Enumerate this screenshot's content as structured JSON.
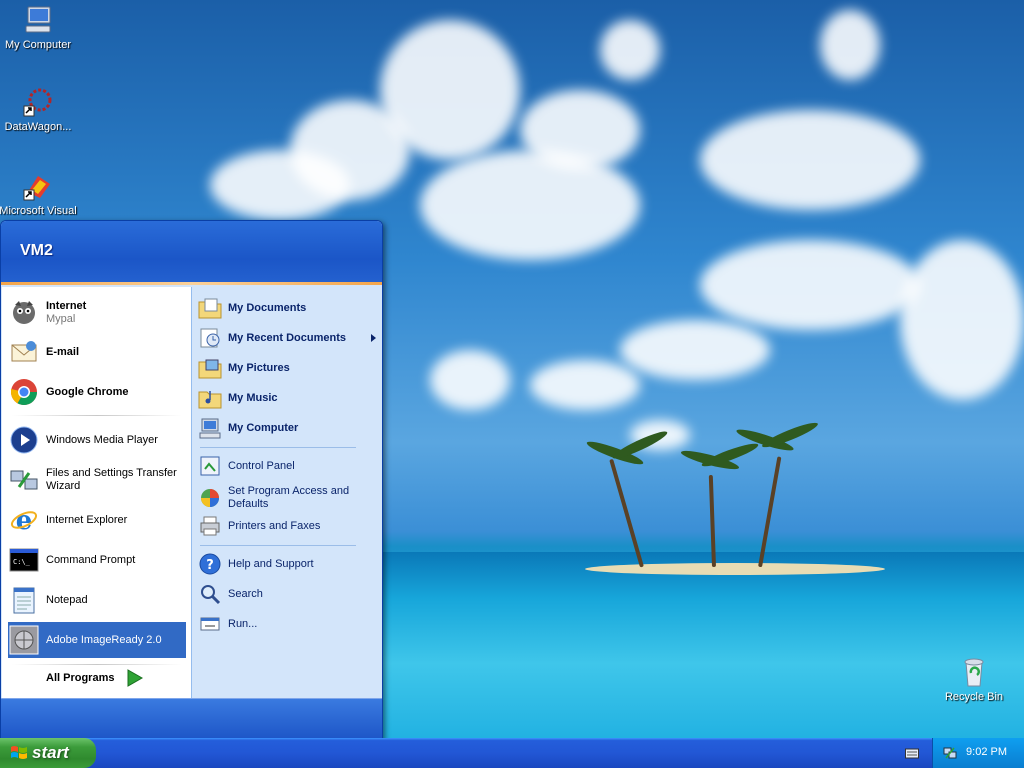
{
  "desktop": {
    "icons": [
      {
        "label": "My Computer"
      },
      {
        "label": "DataWagon..."
      },
      {
        "label": "Microsoft Visual"
      },
      {
        "label": "Recycle Bin"
      }
    ]
  },
  "start_menu": {
    "user": "VM2",
    "pinned": [
      {
        "label": "Internet",
        "sub": "Mypal"
      },
      {
        "label": "E-mail"
      },
      {
        "label": "Google Chrome"
      }
    ],
    "recent": [
      {
        "label": "Windows Media Player"
      },
      {
        "label": "Files and Settings Transfer Wizard"
      },
      {
        "label": "Internet Explorer"
      },
      {
        "label": "Command Prompt"
      },
      {
        "label": "Notepad"
      },
      {
        "label": "Adobe ImageReady 2.0"
      }
    ],
    "all_programs": "All Programs",
    "right": [
      {
        "label": "My Documents"
      },
      {
        "label": "My Recent Documents"
      },
      {
        "label": "My Pictures"
      },
      {
        "label": "My Music"
      },
      {
        "label": "My Computer"
      },
      {
        "label": "Control Panel"
      },
      {
        "label": "Set Program Access and Defaults"
      },
      {
        "label": "Printers and Faxes"
      },
      {
        "label": "Help and Support"
      },
      {
        "label": "Search"
      },
      {
        "label": "Run..."
      }
    ]
  },
  "taskbar": {
    "start_label": "start",
    "clock": "9:02 PM"
  }
}
